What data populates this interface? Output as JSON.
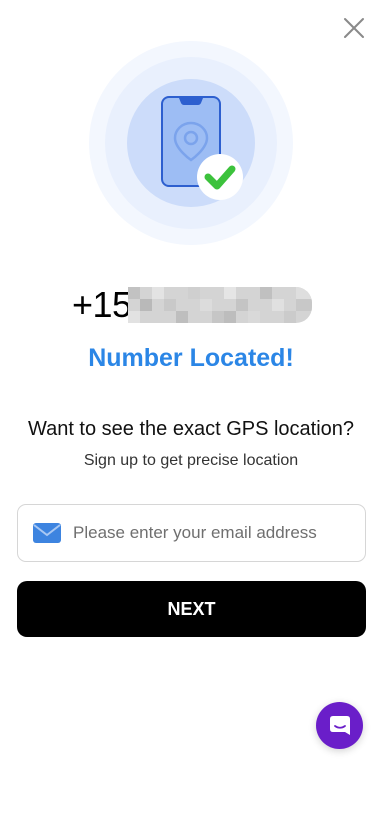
{
  "phone": {
    "prefix": "+15"
  },
  "status": {
    "text": "Number Located!",
    "color": "#2b86e6"
  },
  "prompt": {
    "question": "Want to see the exact GPS location?",
    "subtext": "Sign up to get precise location"
  },
  "email": {
    "placeholder": "Please enter your email address",
    "value": ""
  },
  "buttons": {
    "next_label": "NEXT"
  },
  "icons": {
    "close": "close-icon",
    "hero": "phone-location-check-icon",
    "mail": "mail-icon",
    "chat": "chat-icon"
  },
  "colors": {
    "accent": "#2b86e6",
    "chat": "#6a1ec9",
    "check": "#3cc23c",
    "button": "#000000"
  }
}
